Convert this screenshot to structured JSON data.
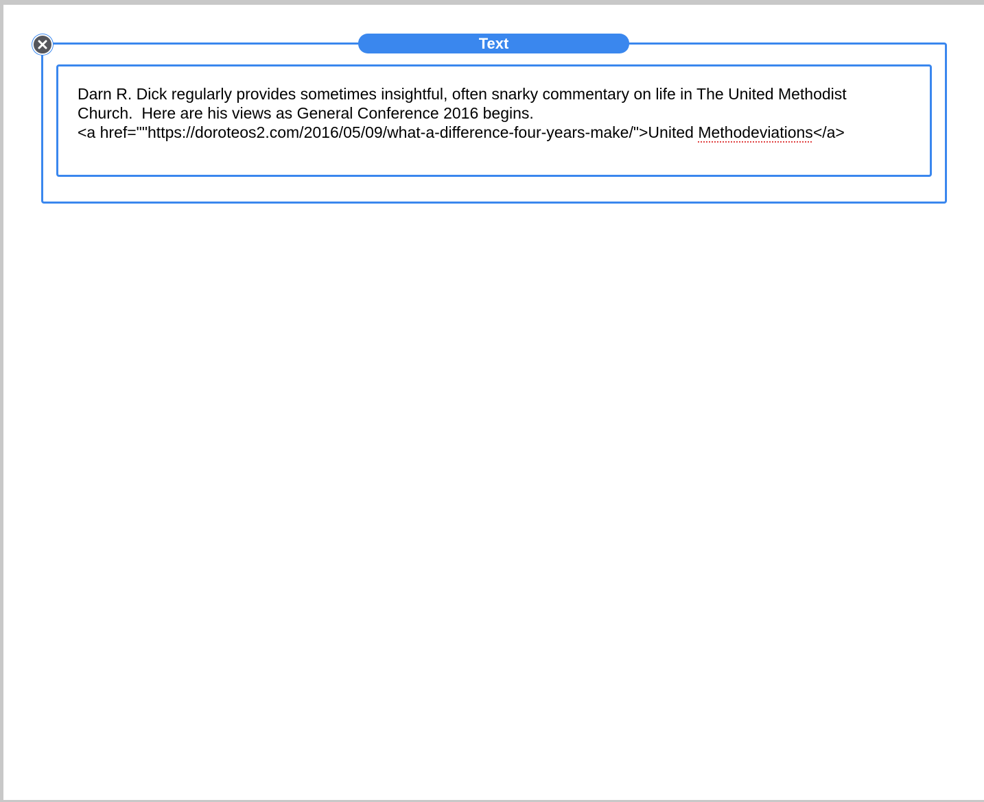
{
  "widget": {
    "title": "Text",
    "close_icon": "close-icon",
    "accent_color": "#3a87ee"
  },
  "editor": {
    "line1": "Darn R. Dick regularly provides sometimes insightful, often snarky commentary on life in The United Methodist",
    "line2": "Church.  Here are his views as General Conference 2016 begins.",
    "line3_prefix": "<a href=\"\"https://doroteos2.com/2016/05/09/what-a-difference-four-years-make/\">United ",
    "line3_misspelled": "Methodeviations",
    "line3_suffix": "</a>"
  }
}
